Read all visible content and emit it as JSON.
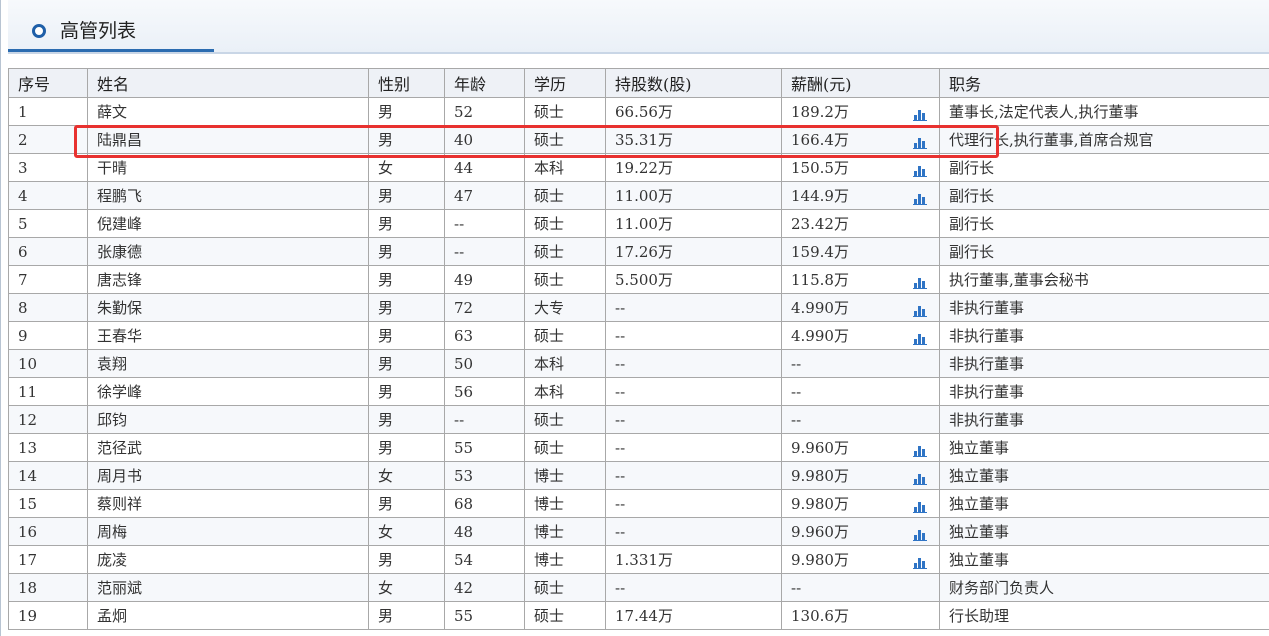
{
  "panel": {
    "title": "高管列表"
  },
  "table": {
    "columns": [
      "序号",
      "姓名",
      "性别",
      "年龄",
      "学历",
      "持股数(股)",
      "薪酬(元)",
      "职务"
    ],
    "rows": [
      {
        "no": "1",
        "name": "薛文",
        "gender": "男",
        "age": "52",
        "edu": "硕士",
        "shares": "66.56万",
        "salary": "189.2万",
        "chart": true,
        "title": "董事长,法定代表人,执行董事"
      },
      {
        "no": "2",
        "name": "陆鼎昌",
        "gender": "男",
        "age": "40",
        "edu": "硕士",
        "shares": "35.31万",
        "salary": "166.4万",
        "chart": true,
        "title": "代理行长,执行董事,首席合规官"
      },
      {
        "no": "3",
        "name": "干晴",
        "gender": "女",
        "age": "44",
        "edu": "本科",
        "shares": "19.22万",
        "salary": "150.5万",
        "chart": true,
        "title": "副行长"
      },
      {
        "no": "4",
        "name": "程鹏飞",
        "gender": "男",
        "age": "47",
        "edu": "硕士",
        "shares": "11.00万",
        "salary": "144.9万",
        "chart": true,
        "title": "副行长"
      },
      {
        "no": "5",
        "name": "倪建峰",
        "gender": "男",
        "age": "--",
        "edu": "硕士",
        "shares": "11.00万",
        "salary": "23.42万",
        "chart": false,
        "title": "副行长"
      },
      {
        "no": "6",
        "name": "张康德",
        "gender": "男",
        "age": "--",
        "edu": "硕士",
        "shares": "17.26万",
        "salary": "159.4万",
        "chart": false,
        "title": "副行长"
      },
      {
        "no": "7",
        "name": "唐志锋",
        "gender": "男",
        "age": "49",
        "edu": "硕士",
        "shares": "5.500万",
        "salary": "115.8万",
        "chart": true,
        "title": "执行董事,董事会秘书"
      },
      {
        "no": "8",
        "name": "朱勤保",
        "gender": "男",
        "age": "72",
        "edu": "大专",
        "shares": "--",
        "salary": "4.990万",
        "chart": true,
        "title": "非执行董事"
      },
      {
        "no": "9",
        "name": "王春华",
        "gender": "男",
        "age": "63",
        "edu": "硕士",
        "shares": "--",
        "salary": "4.990万",
        "chart": true,
        "title": "非执行董事"
      },
      {
        "no": "10",
        "name": "袁翔",
        "gender": "男",
        "age": "50",
        "edu": "本科",
        "shares": "--",
        "salary": "--",
        "chart": false,
        "title": "非执行董事"
      },
      {
        "no": "11",
        "name": "徐学峰",
        "gender": "男",
        "age": "56",
        "edu": "本科",
        "shares": "--",
        "salary": "--",
        "chart": false,
        "title": "非执行董事"
      },
      {
        "no": "12",
        "name": "邱钧",
        "gender": "男",
        "age": "--",
        "edu": "硕士",
        "shares": "--",
        "salary": "--",
        "chart": false,
        "title": "非执行董事"
      },
      {
        "no": "13",
        "name": "范径武",
        "gender": "男",
        "age": "55",
        "edu": "硕士",
        "shares": "--",
        "salary": "9.960万",
        "chart": true,
        "title": "独立董事"
      },
      {
        "no": "14",
        "name": "周月书",
        "gender": "女",
        "age": "53",
        "edu": "博士",
        "shares": "--",
        "salary": "9.980万",
        "chart": true,
        "title": "独立董事"
      },
      {
        "no": "15",
        "name": "蔡则祥",
        "gender": "男",
        "age": "68",
        "edu": "博士",
        "shares": "--",
        "salary": "9.980万",
        "chart": true,
        "title": "独立董事"
      },
      {
        "no": "16",
        "name": "周梅",
        "gender": "女",
        "age": "48",
        "edu": "博士",
        "shares": "--",
        "salary": "9.960万",
        "chart": true,
        "title": "独立董事"
      },
      {
        "no": "17",
        "name": "庞凌",
        "gender": "男",
        "age": "54",
        "edu": "博士",
        "shares": "1.331万",
        "salary": "9.980万",
        "chart": true,
        "title": "独立董事"
      },
      {
        "no": "18",
        "name": "范丽斌",
        "gender": "女",
        "age": "42",
        "edu": "硕士",
        "shares": "--",
        "salary": "--",
        "chart": false,
        "title": "财务部门负责人"
      },
      {
        "no": "19",
        "name": "孟炯",
        "gender": "男",
        "age": "55",
        "edu": "硕士",
        "shares": "17.44万",
        "salary": "130.6万",
        "chart": false,
        "title": "行长助理"
      }
    ]
  },
  "colors": {
    "accent": "#1f5fa8",
    "highlight": "#e8312f",
    "chart_icon": "#2f74c5"
  },
  "icons": {
    "title": "circle-bullet-icon",
    "salary_chart": "bar-chart-icon"
  }
}
